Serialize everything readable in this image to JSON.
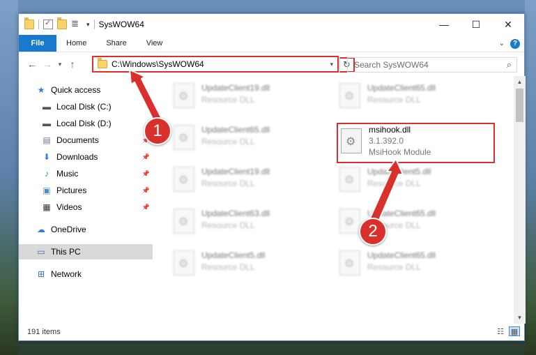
{
  "window": {
    "title": "SysWOW64",
    "controls": {
      "minimize": "—",
      "maximize": "☐",
      "close": "✕"
    }
  },
  "ribbon": {
    "tabs": [
      "File",
      "Home",
      "Share",
      "View"
    ],
    "help": "?"
  },
  "address": {
    "path": "C:\\Windows\\SysWOW64",
    "search_placeholder": "Search SysWOW64"
  },
  "sidebar": {
    "items": [
      {
        "label": "Quick access",
        "icon": "star-icon",
        "pinned": false
      },
      {
        "label": "Local Disk (C:)",
        "icon": "drive-icon",
        "pinned": false
      },
      {
        "label": "Local Disk (D:)",
        "icon": "drive-icon",
        "pinned": false
      },
      {
        "label": "Documents",
        "icon": "documents-icon",
        "pinned": true
      },
      {
        "label": "Downloads",
        "icon": "download-icon",
        "pinned": true
      },
      {
        "label": "Music",
        "icon": "music-icon",
        "pinned": true
      },
      {
        "label": "Pictures",
        "icon": "pictures-icon",
        "pinned": true
      },
      {
        "label": "Videos",
        "icon": "videos-icon",
        "pinned": true
      },
      {
        "label": "OneDrive",
        "icon": "onedrive-icon",
        "pinned": false
      },
      {
        "label": "This PC",
        "icon": "pc-icon",
        "pinned": false,
        "selected": true
      },
      {
        "label": "Network",
        "icon": "network-icon",
        "pinned": false
      }
    ]
  },
  "files": [
    {
      "name": "UpdateClient19.dll",
      "sub": "Resource DLL"
    },
    {
      "name": "UpdateClient65.dll",
      "sub": "Resource DLL"
    },
    {
      "name": "UpdateClient65.dll",
      "sub": "Resource DLL"
    },
    {
      "name": "msihook.dll",
      "version": "3.1.392.0",
      "description": "MsiHook Module",
      "highlighted": true
    },
    {
      "name": "UpdateClient19.dll",
      "sub": "Resource DLL"
    },
    {
      "name": "UpdateClient5.dll",
      "sub": "Resource DLL"
    },
    {
      "name": "UpdateClient63.dll",
      "sub": "Resource DLL"
    },
    {
      "name": "UpdateClient65.dll",
      "sub": "Resource DLL"
    },
    {
      "name": "UpdateClient5.dll",
      "sub": "Resource DLL"
    },
    {
      "name": "UpdateClient65.dll",
      "sub": "Resource DLL"
    }
  ],
  "status": {
    "item_count": "191 items"
  },
  "annotations": {
    "step1": "1",
    "step2": "2",
    "color": "#d9302c"
  }
}
